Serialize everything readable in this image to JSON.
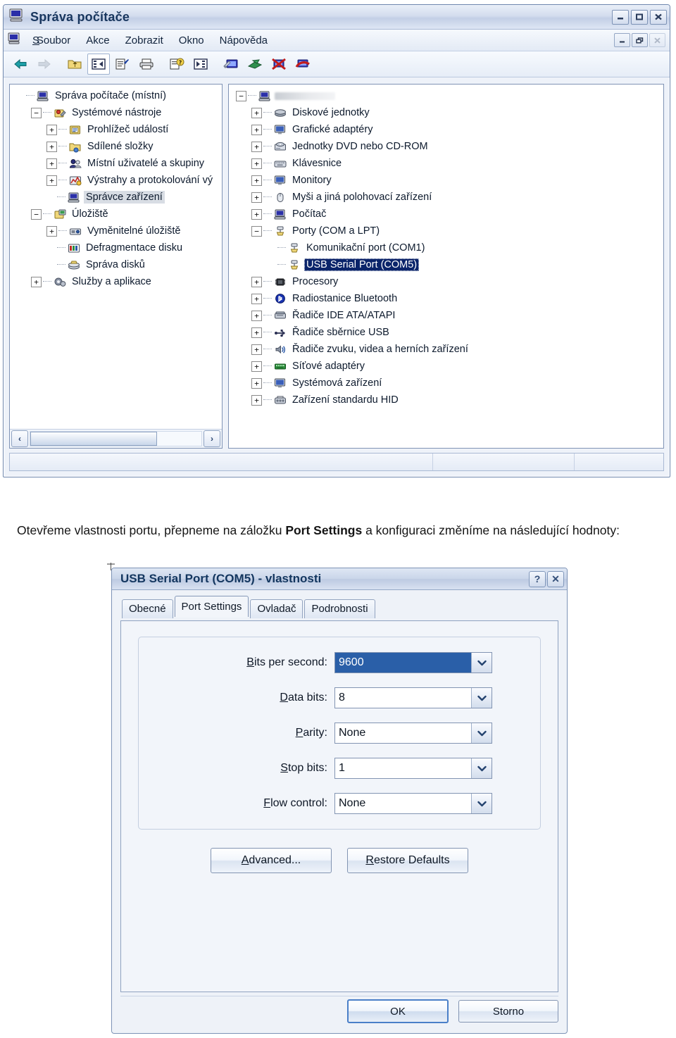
{
  "mmc_window": {
    "title": "Správa počítače",
    "title_icon": "computer-icon",
    "window_buttons": {
      "minimize": "–",
      "maximize": "□",
      "close": "✕"
    },
    "mdi_buttons": {
      "minimize": "–",
      "restore": "❐",
      "close": "✕"
    },
    "menu": [
      {
        "label": "Soubor",
        "accel": "S"
      },
      {
        "label": "Akce",
        "accel": "A"
      },
      {
        "label": "Zobrazit",
        "accel": "Z"
      },
      {
        "label": "Okno",
        "accel": "n"
      },
      {
        "label": "Nápověda",
        "accel": "v"
      }
    ],
    "toolbar": [
      {
        "name": "back-icon",
        "label": "Zpět"
      },
      {
        "name": "forward-icon",
        "label": "Vpřed"
      },
      {
        "name": "up-one-level-icon",
        "label": "O úroveň výš"
      },
      {
        "name": "show-hide-tree-icon",
        "label": "Zobrazit/skrýt strom"
      },
      {
        "name": "properties-icon",
        "label": "Vlastnosti"
      },
      {
        "name": "print-icon",
        "label": "Tisk"
      },
      {
        "name": "help-icon",
        "label": "Nápověda"
      },
      {
        "name": "details-view-icon",
        "label": "Zobrazit podrobnosti"
      },
      {
        "name": "scan-hardware-icon",
        "label": "Vyhledat změny hardwaru"
      },
      {
        "name": "update-driver-icon",
        "label": "Aktualizovat ovladač"
      },
      {
        "name": "disable-device-icon",
        "label": "Zakázat zařízení"
      },
      {
        "name": "uninstall-device-icon",
        "label": "Odinstalovat zařízení"
      }
    ],
    "tree": [
      {
        "label": "Správa počítače (místní)",
        "depth": 0,
        "expander": "none",
        "icon": "computer-icon",
        "state": "normal"
      },
      {
        "label": "Systémové nástroje",
        "depth": 1,
        "expander": "minus",
        "icon": "system-tools-icon",
        "state": "normal"
      },
      {
        "label": "Prohlížeč událostí",
        "depth": 2,
        "expander": "plus",
        "icon": "event-viewer-icon",
        "state": "normal"
      },
      {
        "label": "Sdílené složky",
        "depth": 2,
        "expander": "plus",
        "icon": "shared-folders-icon",
        "state": "normal"
      },
      {
        "label": "Místní uživatelé a skupiny",
        "depth": 2,
        "expander": "plus",
        "icon": "users-groups-icon",
        "state": "normal"
      },
      {
        "label": "Výstrahy a protokolování vý",
        "depth": 2,
        "expander": "plus",
        "icon": "perf-logs-icon",
        "state": "normal"
      },
      {
        "label": "Správce zařízení",
        "depth": 2,
        "expander": "none",
        "icon": "device-manager-icon",
        "state": "selected-inactive"
      },
      {
        "label": "Úložiště",
        "depth": 1,
        "expander": "minus",
        "icon": "storage-icon",
        "state": "normal"
      },
      {
        "label": "Vyměnitelné úložiště",
        "depth": 2,
        "expander": "plus",
        "icon": "removable-storage-icon",
        "state": "normal"
      },
      {
        "label": "Defragmentace disku",
        "depth": 2,
        "expander": "none",
        "icon": "defrag-icon",
        "state": "normal"
      },
      {
        "label": "Správa disků",
        "depth": 2,
        "expander": "none",
        "icon": "disk-management-icon",
        "state": "normal"
      },
      {
        "label": "Služby a aplikace",
        "depth": 1,
        "expander": "plus",
        "icon": "services-apps-icon",
        "state": "normal"
      }
    ],
    "device_list": [
      {
        "label": "",
        "depth": 0,
        "expander": "minus",
        "icon": "computer-icon",
        "state": "redacted"
      },
      {
        "label": "Diskové jednotky",
        "depth": 1,
        "expander": "plus",
        "icon": "disk-drives-icon",
        "state": "normal"
      },
      {
        "label": "Grafické adaptéry",
        "depth": 1,
        "expander": "plus",
        "icon": "display-adapters-icon",
        "state": "normal"
      },
      {
        "label": "Jednotky DVD nebo CD-ROM",
        "depth": 1,
        "expander": "plus",
        "icon": "dvd-cdrom-icon",
        "state": "normal"
      },
      {
        "label": "Klávesnice",
        "depth": 1,
        "expander": "plus",
        "icon": "keyboard-icon",
        "state": "normal"
      },
      {
        "label": "Monitory",
        "depth": 1,
        "expander": "plus",
        "icon": "monitor-icon",
        "state": "normal"
      },
      {
        "label": "Myši a jiná polohovací zařízení",
        "depth": 1,
        "expander": "plus",
        "icon": "mouse-icon",
        "state": "normal"
      },
      {
        "label": "Počítač",
        "depth": 1,
        "expander": "plus",
        "icon": "computer-icon",
        "state": "normal"
      },
      {
        "label": "Porty (COM a LPT)",
        "depth": 1,
        "expander": "minus",
        "icon": "port-icon",
        "state": "normal"
      },
      {
        "label": "Komunikační port (COM1)",
        "depth": 2,
        "expander": "none",
        "icon": "port-icon",
        "state": "normal"
      },
      {
        "label": "USB Serial Port (COM5)",
        "depth": 2,
        "expander": "none",
        "icon": "port-icon",
        "state": "selected-active"
      },
      {
        "label": "Procesory",
        "depth": 1,
        "expander": "plus",
        "icon": "processor-icon",
        "state": "normal"
      },
      {
        "label": "Radiostanice Bluetooth",
        "depth": 1,
        "expander": "plus",
        "icon": "bluetooth-icon",
        "state": "normal"
      },
      {
        "label": "Řadiče IDE ATA/ATAPI",
        "depth": 1,
        "expander": "plus",
        "icon": "ide-controller-icon",
        "state": "normal"
      },
      {
        "label": "Řadiče sběrnice USB",
        "depth": 1,
        "expander": "plus",
        "icon": "usb-controller-icon",
        "state": "normal"
      },
      {
        "label": "Řadiče zvuku, videa a herních zařízení",
        "depth": 1,
        "expander": "plus",
        "icon": "sound-video-icon",
        "state": "normal"
      },
      {
        "label": "Síťové adaptéry",
        "depth": 1,
        "expander": "plus",
        "icon": "network-adapter-icon",
        "state": "normal"
      },
      {
        "label": "Systémová zařízení",
        "depth": 1,
        "expander": "plus",
        "icon": "system-devices-icon",
        "state": "normal"
      },
      {
        "label": "Zařízení standardu HID",
        "depth": 1,
        "expander": "plus",
        "icon": "hid-device-icon",
        "state": "normal"
      }
    ],
    "status_bar": [
      "",
      "",
      ""
    ]
  },
  "caption": {
    "part1": "Otevřeme vlastnosti portu, přepneme na záložku ",
    "bold": "Port Settings",
    "part2": " a konfiguraci změníme na následující hodnoty:"
  },
  "dialog": {
    "title": "USB Serial Port (COM5)  - vlastnosti",
    "help_button": "?",
    "close_button": "✕",
    "tabs": [
      {
        "label": "Obecné",
        "active": false
      },
      {
        "label": "Port Settings",
        "active": true
      },
      {
        "label": "Ovladač",
        "active": false
      },
      {
        "label": "Podrobnosti",
        "active": false
      }
    ],
    "fields": [
      {
        "label": "Bits per second:",
        "accel": "B",
        "value": "9600",
        "selected": true
      },
      {
        "label": "Data bits:",
        "accel": "D",
        "value": "8",
        "selected": false
      },
      {
        "label": "Parity:",
        "accel": "P",
        "value": "None",
        "selected": false
      },
      {
        "label": "Stop bits:",
        "accel": "S",
        "value": "1",
        "selected": false
      },
      {
        "label": "Flow control:",
        "accel": "F",
        "value": "None",
        "selected": false
      }
    ],
    "action_buttons": [
      {
        "label": "Advanced...",
        "accel": "A",
        "default": false
      },
      {
        "label": "Restore Defaults",
        "accel": "R",
        "default": false
      }
    ],
    "footer_buttons": [
      {
        "label": "OK",
        "default": true
      },
      {
        "label": "Storno",
        "default": false
      }
    ]
  },
  "colors": {
    "selection_blue": "#0a246a",
    "combo_selection": "#2a5fa8",
    "title_text": "#13365f",
    "window_border": "#7d93b6",
    "default_button_border": "#4a7fc8"
  }
}
